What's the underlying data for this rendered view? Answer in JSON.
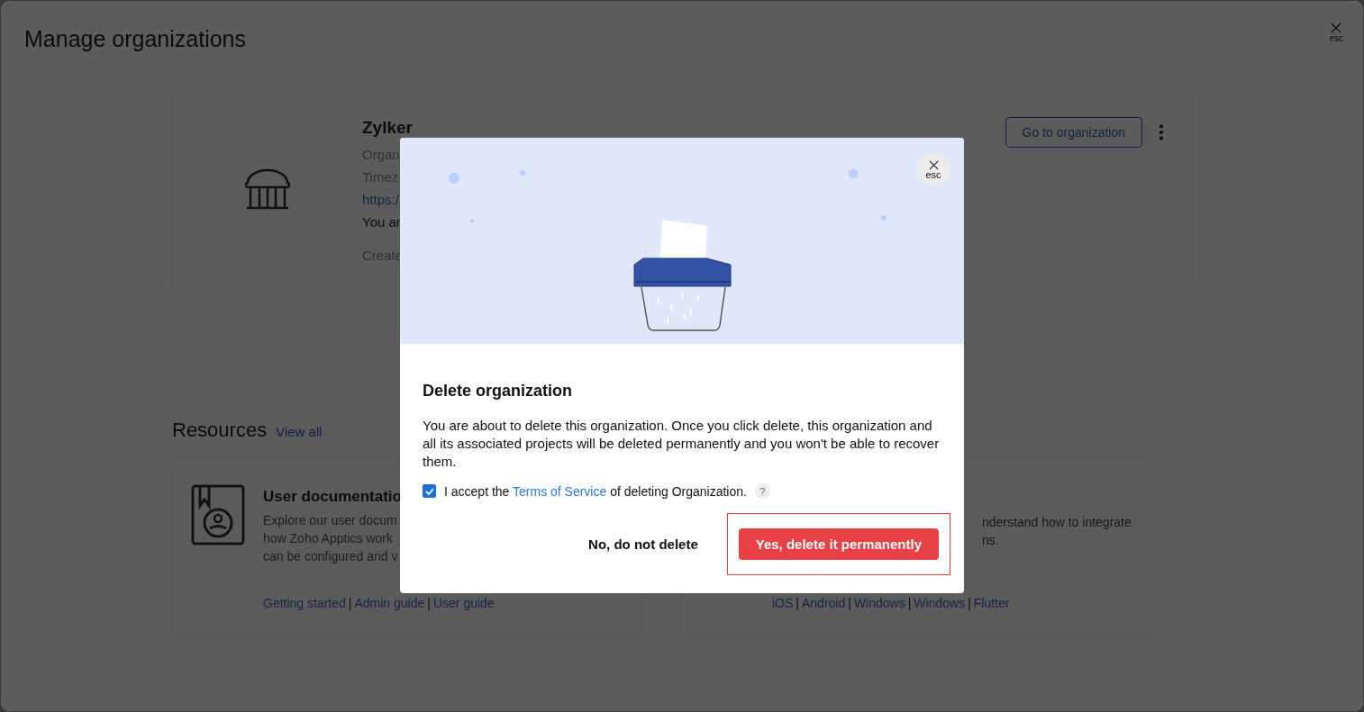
{
  "page": {
    "title": "Manage organizations",
    "close_label": "esc"
  },
  "organization": {
    "name": "Zylker",
    "lines": [
      {
        "kind": "muted",
        "text": "Organ"
      },
      {
        "kind": "muted",
        "text": "Timez"
      },
      {
        "kind": "link",
        "text": "https:/"
      },
      {
        "kind": "plain",
        "text": "You ar"
      },
      {
        "kind": "muted",
        "text": "Create"
      }
    ],
    "primary_button": "Go to organization"
  },
  "resources": {
    "title": "Resources",
    "view_all": "View all",
    "separator": "|",
    "cards": [
      {
        "kind": "docs",
        "title": "User documentatio",
        "description": [
          "Explore our user docum",
          "how Zoho Apptics work",
          "can be configured and v"
        ],
        "links": [
          "Getting started",
          "Admin guide",
          "User guide"
        ]
      },
      {
        "kind": "sdk",
        "description": [
          "nderstand how to integrate",
          "ns."
        ],
        "links": [
          "iOS",
          "Android",
          "Windows",
          "Windows",
          "Flutter"
        ]
      }
    ]
  },
  "dialog": {
    "close_label": "esc",
    "title": "Delete organization",
    "message": "You are about to delete this organization. Once you click delete, this organization and all its associated projects will be deleted permanently and you won't be able to recover them.",
    "consent": {
      "checked": true,
      "before": "I accept the",
      "link": "Terms of Service",
      "after": "of deleting Organization.",
      "help": "?"
    },
    "cancel_button": "No, do not delete",
    "confirm_button": "Yes, delete it permanently",
    "confirm_highlighted": true
  }
}
